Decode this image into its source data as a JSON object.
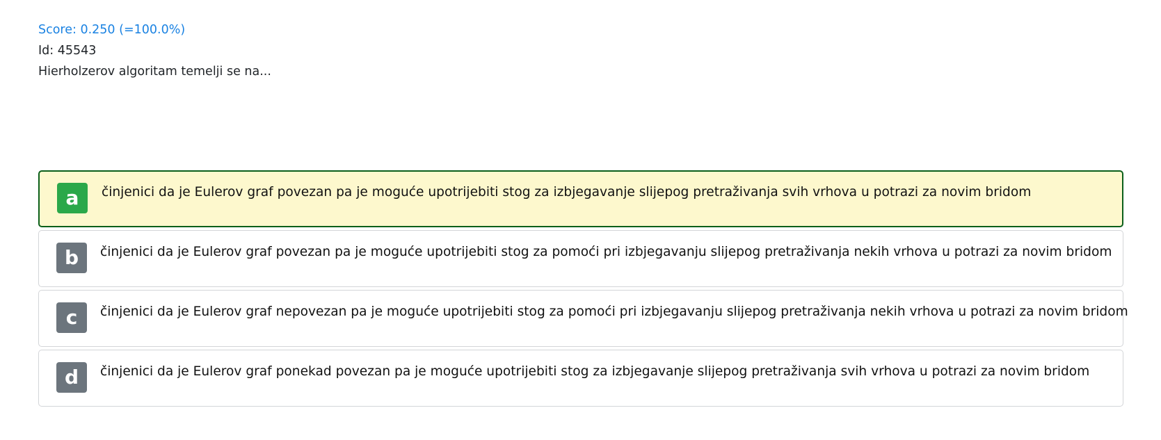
{
  "header": {
    "score": "Score: 0.250 (=100.0%)",
    "id": "Id: 45543",
    "question": "Hierholzerov algoritam temelji se na..."
  },
  "answers": [
    {
      "letter": "a",
      "text": "činjenici da je Eulerov graf povezan pa je moguće upotrijebiti stog za izbjegavanje slijepog pretraživanja svih vrhova u potrazi za novim bridom",
      "selected": true
    },
    {
      "letter": "b",
      "text": "činjenici da je Eulerov graf povezan pa je moguće upotrijebiti stog za pomoći pri izbjegavanju slijepog pretraživanja nekih vrhova u potrazi za novim bridom",
      "selected": false
    },
    {
      "letter": "c",
      "text": "činjenici da je Eulerov graf nepovezan pa je moguće upotrijebiti stog za pomoći pri izbjegavanju slijepog pretraživanja nekih vrhova u potrazi za novim bridom",
      "selected": false
    },
    {
      "letter": "d",
      "text": "činjenici da je Eulerov graf ponekad povezan pa je moguće upotrijebiti stog za izbjegavanje slijepog pretraživanja svih vrhova u potrazi za novim bridom",
      "selected": false
    }
  ],
  "colors": {
    "score_text": "#1a82e2",
    "selected_badge": "#2ba84a",
    "selected_border": "#0b5f1a",
    "selected_background": "#fdf8cd",
    "default_badge": "#6c757d"
  }
}
